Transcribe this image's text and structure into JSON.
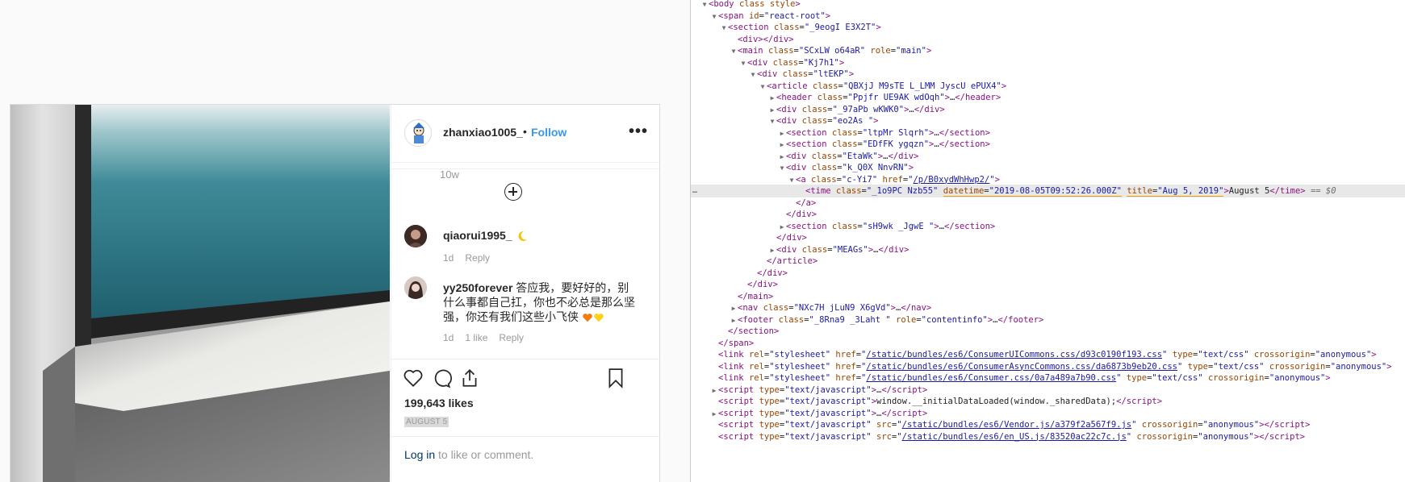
{
  "post": {
    "username": "zhanxiao1005_",
    "follow_sep": "•",
    "follow_label": "Follow",
    "more_label": "•••",
    "prev_comment_time": "10w",
    "comments": [
      {
        "user": "qiaorui1995_",
        "text": "",
        "emoji": "crescent-moon",
        "time": "1d",
        "likes": "",
        "reply": "Reply"
      },
      {
        "user": "yy250forever",
        "text": "答应我，要好好的，别什么事都自己扛，你也不必总是那么坚强，你还有我们这些小飞侠",
        "emoji": "hearts",
        "time": "1d",
        "likes": "1 like",
        "reply": "Reply"
      }
    ],
    "likes": "199,643 likes",
    "date": "AUGUST 5",
    "login_link": "Log in",
    "login_rest": " to like or comment.",
    "icons": [
      "heart-icon",
      "comment-icon",
      "share-icon",
      "bookmark-icon",
      "add-circle-icon",
      "more-icon"
    ]
  },
  "devtools": {
    "lines": [
      {
        "indent": 0,
        "tw": "▼",
        "html": "<span class='tag'>&lt;body</span> <span class='an'>class</span> <span class='an'>style</span><span class='tag'>&gt;</span>"
      },
      {
        "indent": 1,
        "tw": "▼",
        "html": "<span class='tag'>&lt;span</span> <span class='an'>id</span>=<span class='av'>\"react-root\"</span><span class='tag'>&gt;</span>"
      },
      {
        "indent": 2,
        "tw": "▼",
        "html": "<span class='tag'>&lt;section</span> <span class='an'>class</span>=<span class='av'>\"_9eogI E3X2T\"</span><span class='tag'>&gt;</span>"
      },
      {
        "indent": 3,
        "tw": "",
        "html": "<span class='tag'>&lt;div&gt;&lt;/div&gt;</span>"
      },
      {
        "indent": 3,
        "tw": "▼",
        "html": "<span class='tag'>&lt;main</span> <span class='an'>class</span>=<span class='av'>\"SCxLW  o64aR\"</span> <span class='an'>role</span>=<span class='av'>\"main\"</span><span class='tag'>&gt;</span>"
      },
      {
        "indent": 4,
        "tw": "▼",
        "html": "<span class='tag'>&lt;div</span> <span class='an'>class</span>=<span class='av'>\"Kj7h1\"</span><span class='tag'>&gt;</span>"
      },
      {
        "indent": 5,
        "tw": "▼",
        "html": "<span class='tag'>&lt;div</span> <span class='an'>class</span>=<span class='av'>\"ltEKP\"</span><span class='tag'>&gt;</span>"
      },
      {
        "indent": 6,
        "tw": "▼",
        "html": "<span class='tag'>&lt;article</span> <span class='an'>class</span>=<span class='av'>\"QBXjJ M9sTE  L_LMM  JyscU  ePUX4\"</span><span class='tag'>&gt;</span>"
      },
      {
        "indent": 7,
        "tw": "▶",
        "html": "<span class='tag'>&lt;header</span> <span class='an'>class</span>=<span class='av'>\"Ppjfr UE9AK  wdOqh\"</span><span class='tag'>&gt;</span>…<span class='tag'>&lt;/header&gt;</span>"
      },
      {
        "indent": 7,
        "tw": "▶",
        "html": "<span class='tag'>&lt;div</span> <span class='an'>class</span>=<span class='av'>\"_97aPb wKWK0\"</span><span class='tag'>&gt;</span>…<span class='tag'>&lt;/div&gt;</span>"
      },
      {
        "indent": 7,
        "tw": "▼",
        "html": "<span class='tag'>&lt;div</span> <span class='an'>class</span>=<span class='av'>\"eo2As \"</span><span class='tag'>&gt;</span>"
      },
      {
        "indent": 8,
        "tw": "▶",
        "html": "<span class='tag'>&lt;section</span> <span class='an'>class</span>=<span class='av'>\"ltpMr Slqrh\"</span><span class='tag'>&gt;</span>…<span class='tag'>&lt;/section&gt;</span>"
      },
      {
        "indent": 8,
        "tw": "▶",
        "html": "<span class='tag'>&lt;section</span> <span class='an'>class</span>=<span class='av'>\"EDfFK ygqzn\"</span><span class='tag'>&gt;</span>…<span class='tag'>&lt;/section&gt;</span>"
      },
      {
        "indent": 8,
        "tw": "▶",
        "html": "<span class='tag'>&lt;div</span> <span class='an'>class</span>=<span class='av'>\"EtaWk\"</span><span class='tag'>&gt;</span>…<span class='tag'>&lt;/div&gt;</span>"
      },
      {
        "indent": 8,
        "tw": "▼",
        "html": "<span class='tag'>&lt;div</span> <span class='an'>class</span>=<span class='av'>\"k_Q0X NnvRN\"</span><span class='tag'>&gt;</span>"
      },
      {
        "indent": 9,
        "tw": "▼",
        "html": "<span class='tag'>&lt;a</span> <span class='an'>class</span>=<span class='av'>\"c-Yi7\"</span> <span class='an'>href</span>=<span class='av'>\"</span><span class='lnk'>/p/B0xydWhHwp2/</span><span class='av'>\"</span><span class='tag'>&gt;</span>"
      },
      {
        "indent": 10,
        "tw": "",
        "sel": true,
        "html": "<span class='tag'>&lt;time</span> <span class='an'>class</span>=<span class='av'>\"_1o9PC Nzb55\"</span> <span class='hl'><span class='an'>datetime</span>=<span class='av'>\"2019-08-05T09:52:26.000Z\"</span></span> <span class='hl'><span class='an'>title</span>=<span class='av'>\"Aug 5, 2019\"</span></span><span class='tag'>&gt;</span><span class='txt'>August 5</span><span class='tag'>&lt;/time&gt;</span> <span class='cm'>== $0</span>"
      },
      {
        "indent": 9,
        "tw": "",
        "html": "<span class='tag'>&lt;/a&gt;</span>"
      },
      {
        "indent": 8,
        "tw": "",
        "html": "<span class='tag'>&lt;/div&gt;</span>"
      },
      {
        "indent": 8,
        "tw": "▶",
        "html": "<span class='tag'>&lt;section</span> <span class='an'>class</span>=<span class='av'>\"sH9wk  _JgwE \"</span><span class='tag'>&gt;</span>…<span class='tag'>&lt;/section&gt;</span>"
      },
      {
        "indent": 7,
        "tw": "",
        "html": "<span class='tag'>&lt;/div&gt;</span>"
      },
      {
        "indent": 7,
        "tw": "▶",
        "html": "<span class='tag'>&lt;div</span> <span class='an'>class</span>=<span class='av'>\"MEAGs\"</span><span class='tag'>&gt;</span>…<span class='tag'>&lt;/div&gt;</span>"
      },
      {
        "indent": 6,
        "tw": "",
        "html": "<span class='tag'>&lt;/article&gt;</span>"
      },
      {
        "indent": 5,
        "tw": "",
        "html": "<span class='tag'>&lt;/div&gt;</span>"
      },
      {
        "indent": 4,
        "tw": "",
        "html": "<span class='tag'>&lt;/div&gt;</span>"
      },
      {
        "indent": 3,
        "tw": "",
        "html": "<span class='tag'>&lt;/main&gt;</span>"
      },
      {
        "indent": 3,
        "tw": "▶",
        "html": "<span class='tag'>&lt;nav</span> <span class='an'>class</span>=<span class='av'>\"NXc7H jLuN9  X6gVd\"</span><span class='tag'>&gt;</span>…<span class='tag'>&lt;/nav&gt;</span>"
      },
      {
        "indent": 3,
        "tw": "▶",
        "html": "<span class='tag'>&lt;footer</span> <span class='an'>class</span>=<span class='av'>\"_8Rna9  _3Laht \"</span> <span class='an'>role</span>=<span class='av'>\"contentinfo\"</span><span class='tag'>&gt;</span>…<span class='tag'>&lt;/footer&gt;</span>"
      },
      {
        "indent": 2,
        "tw": "",
        "html": "<span class='tag'>&lt;/section&gt;</span>"
      },
      {
        "indent": 1,
        "tw": "",
        "html": "<span class='tag'>&lt;/span&gt;</span>"
      },
      {
        "indent": 1,
        "tw": "",
        "html": "<span class='tag'>&lt;link</span> <span class='an'>rel</span>=<span class='av'>\"stylesheet\"</span> <span class='an'>href</span>=<span class='av'>\"</span><span class='lnk'>/static/bundles/es6/ConsumerUICommons.css/d93c0190f193.css</span><span class='av'>\"</span> <span class='an'>type</span>=<span class='av'>\"text/css\"</span> <span class='an'>crossorigin</span>=<span class='av'>\"anonymous\"</span><span class='tag'>&gt;</span>"
      },
      {
        "indent": 1,
        "tw": "",
        "html": "<span class='tag'>&lt;link</span> <span class='an'>rel</span>=<span class='av'>\"stylesheet\"</span> <span class='an'>href</span>=<span class='av'>\"</span><span class='lnk'>/static/bundles/es6/ConsumerAsyncCommons.css/da6873b9eb20.css</span><span class='av'>\"</span> <span class='an'>type</span>=<span class='av'>\"text/css\"</span> <span class='an'>crossorigin</span>=<span class='av'>\"anonymous\"</span><span class='tag'>&gt;</span>"
      },
      {
        "indent": 1,
        "tw": "",
        "html": "<span class='tag'>&lt;link</span> <span class='an'>rel</span>=<span class='av'>\"stylesheet\"</span> <span class='an'>href</span>=<span class='av'>\"</span><span class='lnk'>/static/bundles/es6/Consumer.css/0a7a489a7b90.css</span><span class='av'>\"</span> <span class='an'>type</span>=<span class='av'>\"text/css\"</span> <span class='an'>crossorigin</span>=<span class='av'>\"anonymous\"</span><span class='tag'>&gt;</span>"
      },
      {
        "indent": 1,
        "tw": "▶",
        "html": "<span class='tag'>&lt;script</span> <span class='an'>type</span>=<span class='av'>\"text/javascript\"</span><span class='tag'>&gt;</span>…<span class='tag'>&lt;/script&gt;</span>"
      },
      {
        "indent": 1,
        "tw": "",
        "html": "<span class='tag'>&lt;script</span> <span class='an'>type</span>=<span class='av'>\"text/javascript\"</span><span class='tag'>&gt;</span><span class='txt'>window.__initialDataLoaded(window._sharedData);</span><span class='tag'>&lt;/script&gt;</span>"
      },
      {
        "indent": 1,
        "tw": "▶",
        "html": "<span class='tag'>&lt;script</span> <span class='an'>type</span>=<span class='av'>\"text/javascript\"</span><span class='tag'>&gt;</span>…<span class='tag'>&lt;/script&gt;</span>"
      },
      {
        "indent": 1,
        "tw": "",
        "html": "<span class='tag'>&lt;script</span> <span class='an'>type</span>=<span class='av'>\"text/javascript\"</span> <span class='an'>src</span>=<span class='av'>\"</span><span class='lnk'>/static/bundles/es6/Vendor.js/a379f2a567f9.js</span><span class='av'>\"</span> <span class='an'>crossorigin</span>=<span class='av'>\"anonymous\"</span><span class='tag'>&gt;&lt;/script&gt;</span>"
      },
      {
        "indent": 1,
        "tw": "",
        "html": "<span class='tag'>&lt;script</span> <span class='an'>type</span>=<span class='av'>\"text/javascript\"</span> <span class='an'>src</span>=<span class='av'>\"</span><span class='lnk'>/static/bundles/es6/en_US.js/83520ac22c7c.js</span><span class='av'>\"</span> <span class='an'>crossorigin</span>=<span class='av'>\"anonymous\"</span><span class='tag'>&gt;&lt;/script&gt;</span>"
      }
    ],
    "selected_marker": "…"
  }
}
